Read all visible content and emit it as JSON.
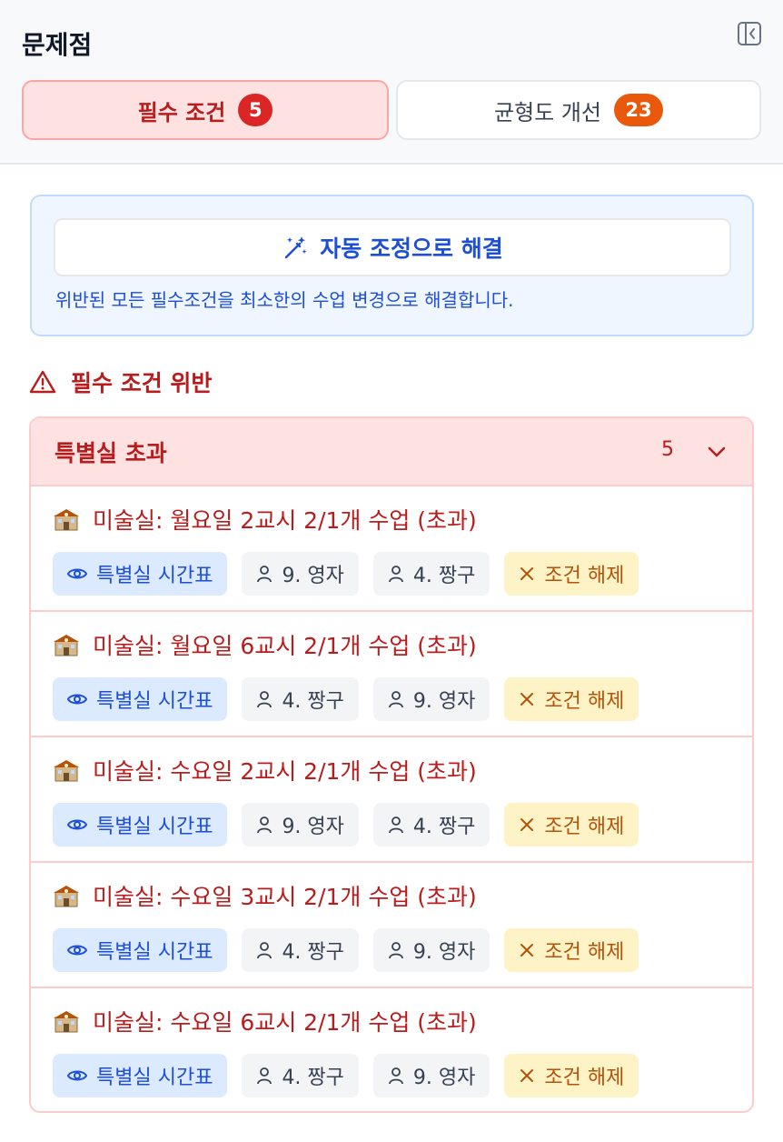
{
  "header": {
    "title": "문제점",
    "tabs": [
      {
        "label": "필수 조건",
        "count": "5"
      },
      {
        "label": "균형도 개선",
        "count": "23"
      }
    ]
  },
  "auto_fix": {
    "button_label": "자동 조정으로 해결",
    "description": "위반된 모든 필수조건을 최소한의 수업 변경으로 해결합니다."
  },
  "violations": {
    "section_title": "필수 조건 위반",
    "group": {
      "title": "특별실 초과",
      "count": "5",
      "items": [
        {
          "title": "미술실: 월요일 2교시 2/1개 수업 (초과)",
          "view_label": "특별실 시간표",
          "teacher_a": "9. 영자",
          "teacher_b": "4. 짱구",
          "release_label": "조건 해제"
        },
        {
          "title": "미술실: 월요일 6교시 2/1개 수업 (초과)",
          "view_label": "특별실 시간표",
          "teacher_a": "4. 짱구",
          "teacher_b": "9. 영자",
          "release_label": "조건 해제"
        },
        {
          "title": "미술실: 수요일 2교시 2/1개 수업 (초과)",
          "view_label": "특별실 시간표",
          "teacher_a": "9. 영자",
          "teacher_b": "4. 짱구",
          "release_label": "조건 해제"
        },
        {
          "title": "미술실: 수요일 3교시 2/1개 수업 (초과)",
          "view_label": "특별실 시간표",
          "teacher_a": "4. 짱구",
          "teacher_b": "9. 영자",
          "release_label": "조건 해제"
        },
        {
          "title": "미술실: 수요일 6교시 2/1개 수업 (초과)",
          "view_label": "특별실 시간표",
          "teacher_a": "4. 짱구",
          "teacher_b": "9. 영자",
          "release_label": "조건 해제"
        }
      ]
    }
  },
  "colors": {
    "danger": "#b91c1c",
    "danger_bg": "#fee2e2",
    "primary": "#1d4ed8",
    "warning": "#b45309",
    "badge_red": "#dc2626",
    "badge_orange": "#ea580c"
  },
  "icons": {
    "collapse": "panel-collapse-icon",
    "auto_fix": "magic-wand-icon",
    "warning": "warning-triangle-icon",
    "chevron": "chevron-down-icon",
    "room": "school-building-icon",
    "view": "eye-icon",
    "teacher": "person-icon",
    "release": "close-icon"
  }
}
